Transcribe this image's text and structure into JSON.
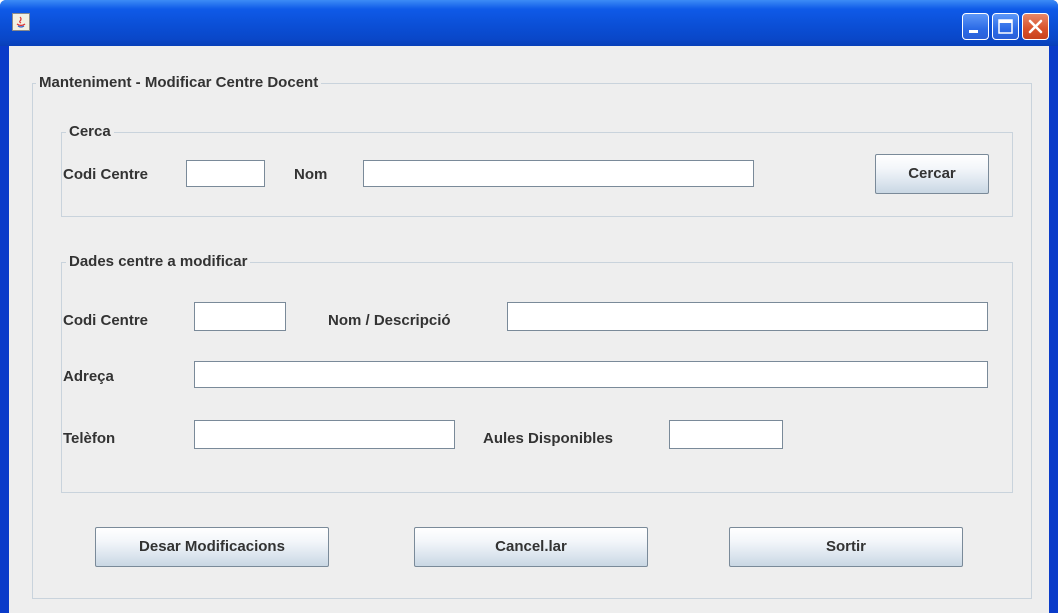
{
  "window": {
    "title": "",
    "controls": {
      "minimize": "minimize-icon",
      "maximize": "maximize-icon",
      "close": "close-icon"
    },
    "colors": {
      "titlebar": "#0b4fd6",
      "client": "#eeeeee",
      "close_button": "#d9512a"
    }
  },
  "main_group": {
    "title": "Manteniment - Modificar Centre Docent"
  },
  "search": {
    "title": "Cerca",
    "code_label": "Codi Centre",
    "code_value": "",
    "name_label": "Nom",
    "name_value": "",
    "search_button": "Cercar"
  },
  "edit": {
    "title": "Dades centre a modificar",
    "code_label": "Codi Centre",
    "code_value": "",
    "description_label": "Nom / Descripció",
    "description_value": "",
    "address_label": "Adreça",
    "address_value": "",
    "phone_label": "Telèfon",
    "phone_value": "",
    "rooms_label": "Aules Disponibles",
    "rooms_value": ""
  },
  "actions": {
    "save": "Desar Modificacions",
    "cancel": "Cancel.lar",
    "exit": "Sortir"
  }
}
